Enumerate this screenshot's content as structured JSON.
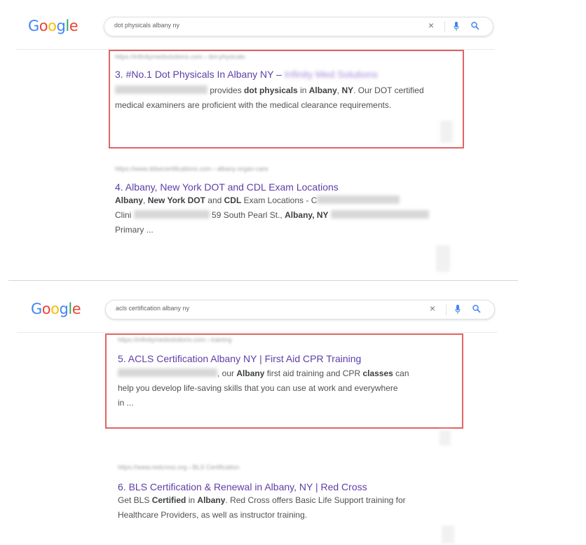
{
  "brand": {
    "logo_letters": [
      "G",
      "o",
      "o",
      "g",
      "l",
      "e"
    ],
    "logo_colors": [
      "#4285F4",
      "#EA4335",
      "#FBBC05",
      "#4285F4",
      "#34A853",
      "#EA4335"
    ]
  },
  "accent": {
    "red_box": "#e06464",
    "link": "#5b3fa7"
  },
  "panels": [
    {
      "query": "dot physicals albany ny",
      "results": [
        {
          "cite": "https://infinitymedsolutions.com › dot-physicals",
          "number_title": "3. #No.1 Dot Physicals In Albany NY –",
          "title_tail": "Infinity Med Solutions",
          "s1": "provides",
          "s2": "dot physicals",
          "s3": "in",
          "s4": "Albany",
          "s5": ",",
          "s6": "NY",
          "s7": ". Our DOT certified",
          "s8": "medical examiners are proficient with the medical clearance requirements."
        },
        {
          "cite": "https://www.ddsecertifications.com › albany-organ-care",
          "number_title": "4. Albany, New York DOT and CDL Exam Locations",
          "s1": "Albany",
          "s2": ", ",
          "s3": "New York DOT",
          "s4": " and ",
          "s5": "CDL",
          "s6": " Exam Locations - C",
          "s7": "Clini",
          "s8": "59 South Pearl St., ",
          "s9": "Albany, NY",
          "s10": "Primary ..."
        }
      ]
    },
    {
      "query": "acls certification albany ny",
      "results": [
        {
          "cite": "https://infinitymedsolutions.com › training",
          "number_title": "5. ACLS Certification Albany NY | First Aid CPR Training",
          "s1": ", our ",
          "s2": "Albany",
          "s3": " first aid training and CPR ",
          "s4": "classes",
          "s5": " can",
          "s6": "help you develop life-saving skills that you can use at work and everywhere",
          "s7": "in ..."
        },
        {
          "cite": "https://www.redcross.org › BLS Certification",
          "number_title": "6. BLS Certification & Renewal in Albany, NY | Red Cross",
          "s1": "Get BLS ",
          "s2": "Certified",
          "s3": " in ",
          "s4": "Albany",
          "s5": ". Red Cross offers Basic Life Support training for",
          "s6": "Healthcare Providers, as well as instructor training."
        }
      ]
    }
  ]
}
